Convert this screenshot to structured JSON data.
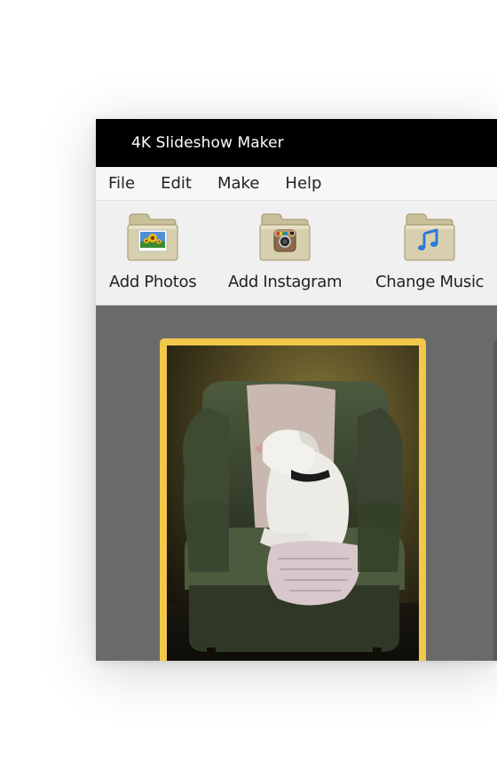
{
  "window": {
    "title": "4K Slideshow Maker"
  },
  "menu": {
    "items": [
      "File",
      "Edit",
      "Make",
      "Help"
    ]
  },
  "toolbar": {
    "add_photos_label": "Add Photos",
    "add_instagram_label": "Add Instagram",
    "change_music_label": "Change Music"
  },
  "icons": {
    "add_photos": "sunflower-photo-folder-icon",
    "add_instagram": "instagram-folder-icon",
    "change_music": "music-note-folder-icon"
  },
  "colors": {
    "titlebar_bg": "#000000",
    "content_bg": "#6a6a6a",
    "selection_border": "#f2c84b",
    "folder_tan": "#d8cfae",
    "music_blue": "#2d7ad6"
  }
}
